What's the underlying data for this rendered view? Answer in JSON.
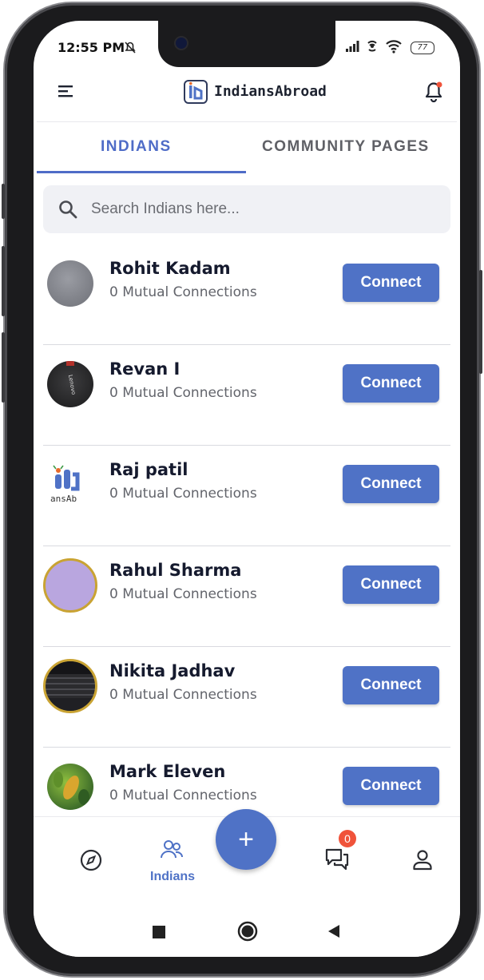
{
  "status_bar": {
    "time": "12:55 PM",
    "battery": "77"
  },
  "app_bar": {
    "title": "IndiansAbroad"
  },
  "tabs": [
    {
      "label": "INDIANS",
      "active": true
    },
    {
      "label": "COMMUNITY PAGES",
      "active": false
    }
  ],
  "search": {
    "placeholder": "Search Indians here..."
  },
  "people": [
    {
      "name": "Rohit Kadam",
      "mutual": "0 Mutual Connections",
      "action": "Connect",
      "avatar": "gray-avatar-icon"
    },
    {
      "name": "Revan I",
      "mutual": "0 Mutual Connections",
      "action": "Connect",
      "avatar": "lenovo-photo-icon"
    },
    {
      "name": "Raj patil",
      "mutual": "0 Mutual Connections",
      "action": "Connect",
      "avatar": "indiansabroad-logo-icon"
    },
    {
      "name": "Rahul Sharma",
      "mutual": "0 Mutual Connections",
      "action": "Connect",
      "avatar": "purple-avatar-icon"
    },
    {
      "name": "Nikita Jadhav",
      "mutual": "0 Mutual Connections",
      "action": "Connect",
      "avatar": "keyboard-photo-icon"
    },
    {
      "name": "Mark Eleven",
      "mutual": "0 Mutual Connections",
      "action": "Connect",
      "avatar": "leaf-photo-icon"
    }
  ],
  "bottom_nav": {
    "items": [
      {
        "icon": "compass-icon"
      },
      {
        "icon": "people-icon",
        "label": "Indians",
        "active": true
      },
      {
        "icon": "plus-icon",
        "fab": "+"
      },
      {
        "icon": "chat-icon",
        "badge": "0"
      },
      {
        "icon": "profile-icon"
      }
    ]
  },
  "colors": {
    "accent": "#4f72c6",
    "tab_active": "#4f6cc7",
    "badge": "#f0533a",
    "ring": "#c9a333"
  }
}
